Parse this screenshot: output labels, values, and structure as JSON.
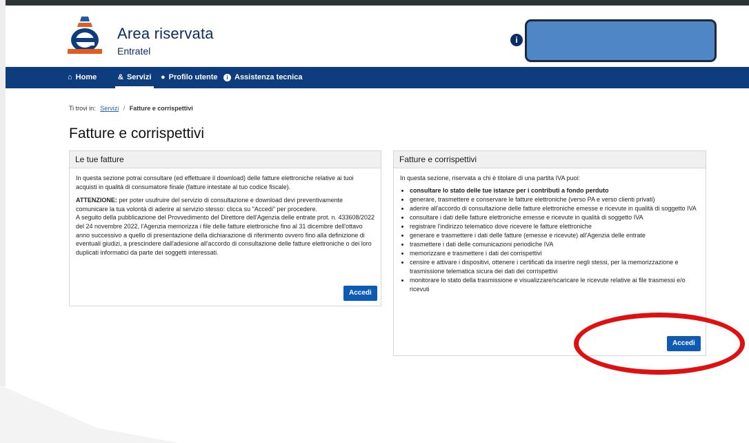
{
  "header": {
    "app_title": "Area riservata",
    "app_subtitle": "Entratel",
    "info_icon": "i",
    "user_box_color": "#4f86c6"
  },
  "nav": {
    "items": [
      {
        "icon": "home-icon",
        "glyph": "⌂",
        "label": "Home"
      },
      {
        "icon": "services-icon",
        "glyph": "&",
        "label": "Servizi"
      },
      {
        "icon": "user-icon",
        "glyph": "●",
        "label": "Profilo utente"
      },
      {
        "icon": "info-icon",
        "glyph": "i",
        "label": "Assistenza tecnica"
      }
    ],
    "active": "Servizi"
  },
  "breadcrumb": {
    "prefix": "Ti trovi in:",
    "link": "Servizi",
    "separator": "/",
    "current": "Fatture e corrispettivi"
  },
  "page_title": "Fatture e corrispettivi",
  "left_card": {
    "title": "Le tue fatture",
    "intro": "In questa sezione potrai consultare (ed effettuare il download) delle fatture elettroniche relative ai tuoi acquisti in qualità di consumatore finale (fatture intestate al tuo codice fiscale).",
    "attention_label": "ATTENZIONE:",
    "attention_text": " per poter usufruire del servizio di consultazione e download devi preventivamente comunicare la tua volontà di aderire al servizio stesso: clicca su \"Accedi\" per procedere.",
    "note": "A seguito della pubblicazione del Provvedimento del Direttore dell'Agenzia delle entrate prot. n. 433608/2022 del 24 novembre 2022, l'Agenzia memorizza i file delle fatture elettroniche fino al 31 dicembre dell'ottavo anno successivo a quello di presentazione della dichiarazione di riferimento ovvero fino alla definizione di eventuali giudizi, a prescindere dall'adesione all'accordo di consultazione delle fatture elettroniche o dei loro duplicati informatici da parte dei soggetti interessati.",
    "button": "Accedi"
  },
  "right_card": {
    "title": "Fatture e corrispettivi",
    "intro": "In questa sezione, riservata a chi è titolare di una partita IVA puoi:",
    "items": [
      "consultare lo stato delle tue istanze per i contributi a fondo perduto",
      "generare, trasmettere e conservare le fatture elettroniche (verso PA e verso clienti privati)",
      "aderire all'accordo di consultazione delle fatture elettroniche emesse e ricevute in qualità di soggetto IVA",
      "consultare i dati delle fatture elettroniche emesse e ricevute in qualità di soggetto IVA",
      "registrare l'indirizzo telematico dove ricevere le fatture elettroniche",
      "generare e trasmettere i dati delle fatture (emesse e ricevute) all'Agenzia delle entrate",
      "trasmettere i dati delle comunicazioni periodiche IVA",
      "memorizzare e trasmettere i dati dei corrispettivi",
      "censire e attivare i dispositivi, ottenere i certificati da inserire negli stessi, per la memorizzazione e trasmissione telematica sicura dei dati dei corrispettivi",
      "monitorare lo stato della trasmissione e visualizzare/scaricare le ricevute relative ai file trasmessi e/o ricevuti"
    ],
    "button": "Accedi"
  },
  "annotation": {
    "color": "#e01010"
  }
}
